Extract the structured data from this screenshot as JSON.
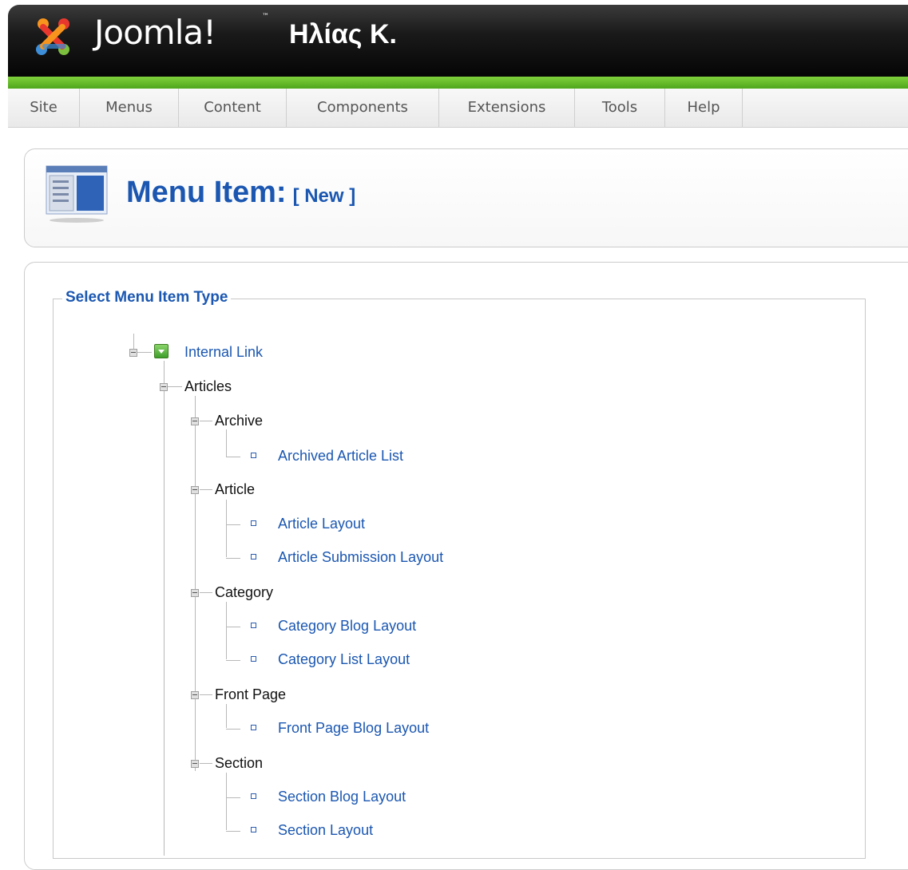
{
  "header": {
    "logo_text": "Joomla!",
    "logo_tm": "™",
    "user_name": "Ηλίας Κ."
  },
  "menubar": {
    "items": [
      "Site",
      "Menus",
      "Content",
      "Components",
      "Extensions",
      "Tools",
      "Help"
    ]
  },
  "page": {
    "title": "Menu Item:",
    "subtitle": "[ New ]"
  },
  "fieldset": {
    "legend": "Select Menu Item Type"
  },
  "tree": {
    "root": "Internal Link",
    "level1": "Articles",
    "groups": [
      {
        "label": "Archive",
        "items": [
          "Archived Article List"
        ]
      },
      {
        "label": "Article",
        "items": [
          "Article Layout",
          "Article Submission Layout"
        ]
      },
      {
        "label": "Category",
        "items": [
          "Category Blog Layout",
          "Category List Layout"
        ]
      },
      {
        "label": "Front Page",
        "items": [
          "Front Page Blog Layout"
        ]
      },
      {
        "label": "Section",
        "items": [
          "Section Blog Layout",
          "Section Layout"
        ]
      }
    ]
  },
  "colors": {
    "link_blue": "#1b57b1",
    "header_black": "#111111",
    "header_green": "#5db32a"
  }
}
